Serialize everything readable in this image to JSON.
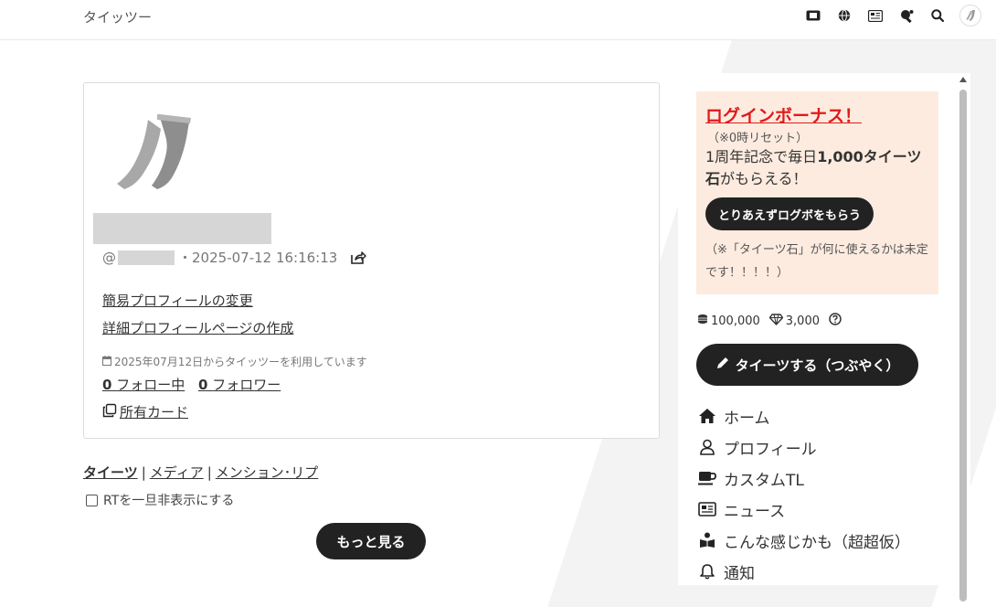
{
  "site": {
    "title": "タイッツー"
  },
  "topbar": {
    "icons": [
      "ticket-icon",
      "globe-icon",
      "news-icon",
      "ping-pong-icon",
      "search-icon",
      "user-avatar"
    ]
  },
  "profile": {
    "handle_prefix": "@",
    "separator": "・",
    "joined_datetime": "2025-07-12 16:16:13",
    "links": {
      "simple_profile": "簡易プロフィールの変更",
      "detail_profile": "詳細プロフィールページの作成"
    },
    "since_text": "2025年07月12日からタイッツーを利用しています",
    "following_count": "0",
    "following_label": "フォロー中",
    "followers_count": "0",
    "followers_label": "フォロワー",
    "cards_label": "所有カード"
  },
  "tabs": {
    "items": [
      "タイーツ",
      "メディア",
      "メンション･リプ"
    ],
    "separator": "|",
    "active": "タイーツ"
  },
  "rt_toggle": {
    "label": "RTを一旦非表示にする",
    "checked": false
  },
  "more_button": {
    "label": "もっと見る"
  },
  "sidebar": {
    "bonus": {
      "title": "ログインボーナス！",
      "note": "（※0時リセット）",
      "body_prefix": "1周年記念で毎日",
      "body_bold": "1,000タイーツ石",
      "body_suffix": "がもらえる！",
      "button": "とりあえずログボをもらう",
      "footer": "（※「タイーツ石」が何に使えるかは未定です！！！！）"
    },
    "stats": {
      "coins": "100,000",
      "gems": "3,000"
    },
    "tweet_button": "タイーツする（つぶやく）",
    "nav": [
      {
        "label": "ホーム",
        "icon": "home-icon"
      },
      {
        "label": "プロフィール",
        "icon": "user-icon"
      },
      {
        "label": "カスタムTL",
        "icon": "coffee-icon"
      },
      {
        "label": "ニュース",
        "icon": "newspaper-icon"
      },
      {
        "label": "こんな感じかも（超超仮）",
        "icon": "reading-icon"
      },
      {
        "label": "通知",
        "icon": "bell-icon"
      }
    ]
  },
  "colors": {
    "accent_dark": "#222222",
    "bonus_bg": "#fdebdf",
    "bonus_title": "#e01a1a"
  }
}
